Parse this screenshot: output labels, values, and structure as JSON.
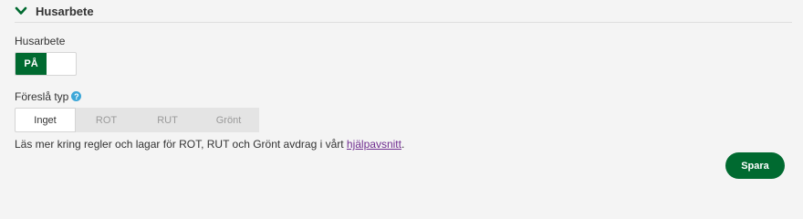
{
  "section": {
    "title": "Husarbete",
    "chevron_icon": "chevron-down-icon",
    "accent_color": "#006a30"
  },
  "husarbete_field": {
    "label": "Husarbete",
    "toggle_label": "PÅ",
    "toggle_state": "on"
  },
  "suggest_type": {
    "label": "Föreslå typ",
    "help_icon": "help-icon",
    "help_glyph": "?",
    "options": [
      "Inget",
      "ROT",
      "RUT",
      "Grönt"
    ],
    "selected": "Inget"
  },
  "info": {
    "text": "Läs mer kring regler och lagar för ROT, RUT och Grönt avdrag i vårt ",
    "link_text": "hjälpavsnitt",
    "suffix": "."
  },
  "actions": {
    "save_label": "Spara"
  }
}
